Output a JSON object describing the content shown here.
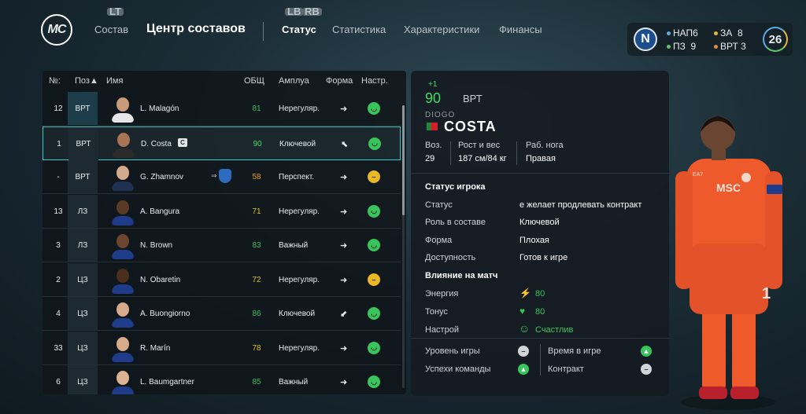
{
  "header": {
    "logo": "MC",
    "nav_prev": "Состав",
    "title": "Центр составов",
    "tabs": [
      "Статус",
      "Статистика",
      "Характеристики",
      "Финансы"
    ],
    "active_tab": 0,
    "kbd_lt": "LT",
    "kbd_lb": "LB",
    "kbd_rb": "RB"
  },
  "club": {
    "crest_letter": "N",
    "stats": [
      {
        "label": "НАП",
        "value": "6",
        "color": "#5fa9e0"
      },
      {
        "label": "ЗА",
        "value": "8",
        "color": "#e4b83e"
      },
      {
        "label": "ПЗ",
        "value": "9",
        "color": "#5fc46a"
      },
      {
        "label": "ВРТ",
        "value": "3",
        "color": "#e0903a"
      }
    ],
    "day": "26"
  },
  "table": {
    "headers": {
      "num": "№:",
      "pos": "Поз▲",
      "name": "Имя",
      "ovr": "ОБЩ",
      "role": "Амплуа",
      "form": "Форма",
      "mood": "Настр."
    },
    "rows": [
      {
        "num": "12",
        "pos": "ВРТ",
        "name": "L. Malagón",
        "ovr": "81",
        "ovr_color": "#3fbf5a",
        "role": "Нерегуляр.",
        "form": "➜",
        "mood": "happy",
        "skin": "#c89a7a",
        "shirt": "#e6e6e6"
      },
      {
        "num": "1",
        "pos": "ВРТ",
        "name": "D. Costa",
        "ovr": "90",
        "ovr_color": "#3fdc5e",
        "role": "Ключевой",
        "form": "⬉",
        "mood": "happy",
        "skin": "#a77455",
        "shirt": "#2b2b2b"
      },
      {
        "num": "-",
        "pos": "ВРТ",
        "name": "G. Zhamnov",
        "ovr": "58",
        "ovr_color": "#e0a020",
        "role": "Перспект.",
        "form": "➜",
        "mood": "meh",
        "skin": "#d2aa8c",
        "shirt": "#1e3150"
      },
      {
        "num": "13",
        "pos": "ЛЗ",
        "name": "A. Bangura",
        "ovr": "71",
        "ovr_color": "#d9c22a",
        "role": "Нерегуляр.",
        "form": "➜",
        "mood": "happy",
        "skin": "#5a3a26",
        "shirt": "#1e3c8a"
      },
      {
        "num": "3",
        "pos": "ЛЗ",
        "name": "N. Brown",
        "ovr": "83",
        "ovr_color": "#3fbf5a",
        "role": "Важный",
        "form": "➜",
        "mood": "happy",
        "skin": "#6b4530",
        "shirt": "#1e3c8a"
      },
      {
        "num": "2",
        "pos": "ЦЗ",
        "name": "N. Obaretin",
        "ovr": "72",
        "ovr_color": "#d9c22a",
        "role": "Нерегуляр.",
        "form": "➜",
        "mood": "meh",
        "skin": "#4a2e1e",
        "shirt": "#1e3c8a"
      },
      {
        "num": "4",
        "pos": "ЦЗ",
        "name": "A. Buongiorno",
        "ovr": "86",
        "ovr_color": "#3fbf5a",
        "role": "Ключевой",
        "form": "⬋",
        "mood": "happy",
        "skin": "#d6ab8c",
        "shirt": "#1e3c8a"
      },
      {
        "num": "33",
        "pos": "ЦЗ",
        "name": "R. Marín",
        "ovr": "78",
        "ovr_color": "#d9c22a",
        "role": "Нерегуляр.",
        "form": "➜",
        "mood": "happy",
        "skin": "#d6ab8c",
        "shirt": "#1e3c8a"
      },
      {
        "num": "6",
        "pos": "ЦЗ",
        "name": "L. Baumgartner",
        "ovr": "85",
        "ovr_color": "#3fbf5a",
        "role": "Важный",
        "form": "➜",
        "mood": "happy",
        "skin": "#dcb394",
        "shirt": "#1e3c8a"
      }
    ],
    "selected_row": 1,
    "transfer_arrows": "⇒"
  },
  "player": {
    "delta": "+1",
    "overall": "90",
    "position": "ВРТ",
    "first_name": "DIOGO",
    "last_name": "COSTA",
    "age_label": "Воз.",
    "age": "29",
    "size_label": "Рост и вес",
    "size": "187 см/84 кг",
    "foot_label": "Раб. нога",
    "foot": "Правая",
    "status_heading": "Статус игрока",
    "status_rows": [
      {
        "label": "Статус",
        "value": "е желает продлевать контракт"
      },
      {
        "label": "Роль в составе",
        "value": "Ключевой"
      },
      {
        "label": "Форма",
        "value": "Плохая"
      },
      {
        "label": "Доступность",
        "value": "Готов к игре"
      }
    ],
    "impact_heading": "Влияние на матч",
    "impact_rows": [
      {
        "label": "Энергия",
        "value": "80",
        "icon": "⚡"
      },
      {
        "label": "Тонус",
        "value": "80",
        "icon": "♥"
      },
      {
        "label": "Настрой",
        "value": "Счастлив",
        "icon": "☺"
      }
    ],
    "morale": [
      {
        "label": "Уровень игры",
        "state": "neutral"
      },
      {
        "label": "Время в игре",
        "state": "up"
      },
      {
        "label": "Успехи команды",
        "state": "up"
      },
      {
        "label": "Контракт",
        "state": "neutral"
      }
    ],
    "kit_sponsor": "MSC",
    "kit_number": "1"
  },
  "colors": {
    "accent": "#3fc8c4",
    "positive": "#39c55b",
    "warning": "#e9b824",
    "kit": "#ef5a2c"
  }
}
